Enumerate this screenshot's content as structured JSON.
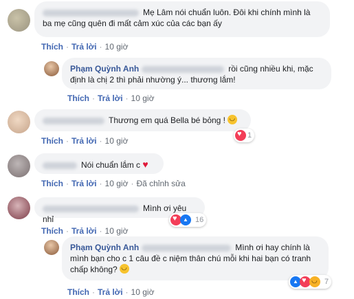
{
  "actions": {
    "like": "Thích",
    "reply": "Trả lời",
    "separator": "·"
  },
  "comments": [
    {
      "text": "Mẹ Lâm nói chuẩn luôn. Đôi khi chính mình là ba mẹ cũng quên đi mất cảm xúc của các bạn ấy",
      "time": "10 giờ"
    },
    {
      "author": "Phạm Quỳnh Anh",
      "text": "rồi cũng nhiều khi, mặc định là chị 2 thì phải nhường ý... thương lắm!",
      "time": "10 giờ"
    },
    {
      "text": "Thương em quá Bella bé bỏng !",
      "time": "10 giờ",
      "reactions_count": "1",
      "emoji": "smile-emoji"
    },
    {
      "text": "Nói chuẩn lắm c",
      "time": "10 giờ",
      "edited": "Đã chỉnh sửa",
      "emoji": "red-heart"
    },
    {
      "text": "Mình ơi yêu nhỉ",
      "time": "10 giờ",
      "reactions_count": "16"
    },
    {
      "author": "Phạm Quỳnh Anh",
      "text": "Mình ơi hay chính là mình bạn cho c 1 câu đề c niệm thân chú mỗi khi hai bạn có tranh chấp không?",
      "time": "10 giờ",
      "reactions_count": "7",
      "emoji": "grin-emoji"
    }
  ],
  "colors": {
    "link": "#4267b2",
    "name": "#385898",
    "bubble": "#f2f3f5",
    "heart": "#f33e58",
    "like": "#1877f2",
    "haha": "#f7b125"
  }
}
